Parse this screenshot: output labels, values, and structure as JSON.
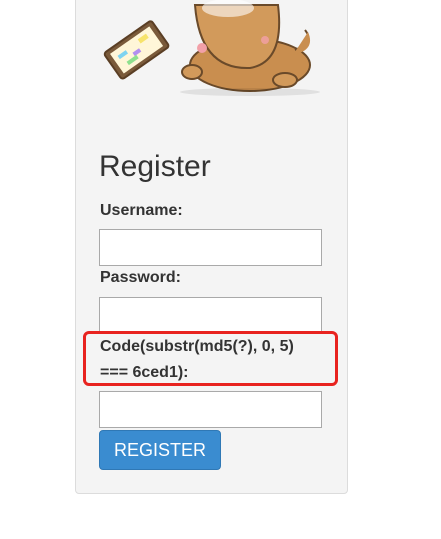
{
  "form": {
    "title": "Register",
    "username_label": "Username:",
    "username_value": "",
    "password_label": "Password:",
    "password_value": "",
    "code_label": "Code(substr(md5(?), 0, 5)\n=== 6ced1):",
    "code_value": "",
    "submit_label": "REGISTER"
  },
  "colors": {
    "panel_bg": "#f4f4f4",
    "button_bg": "#3a8cd0",
    "highlight_border": "#e8231f",
    "mascot_body": "#c98e4f"
  },
  "mascot": {
    "icon": "puppy-with-laptop-icon"
  }
}
